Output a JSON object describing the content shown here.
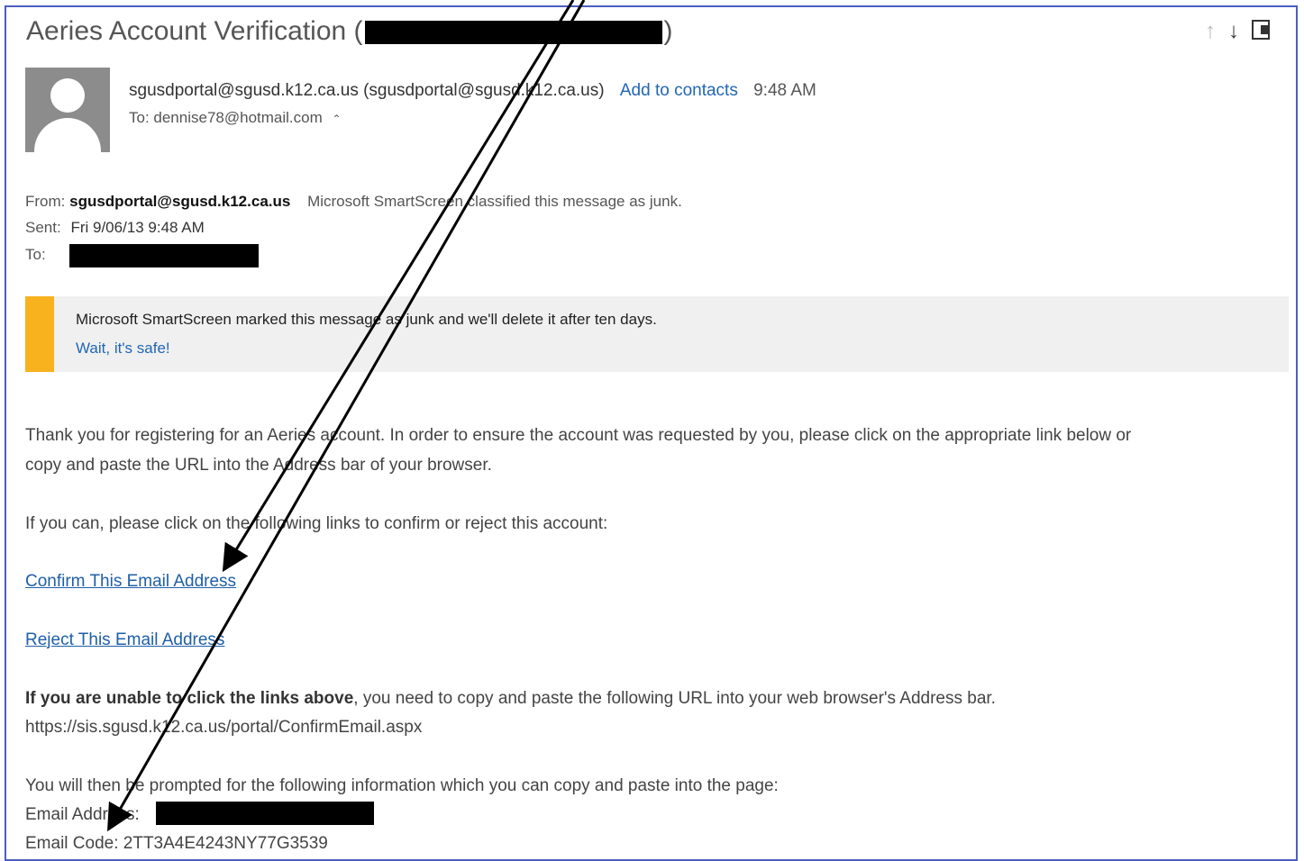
{
  "email": {
    "subject": "Aeries Account Verification (",
    "subject_close": ")",
    "sender_line": "sgusdportal@sgusd.k12.ca.us (sgusdportal@sgusd.k12.ca.us)",
    "add_to_contacts": "Add to contacts",
    "time": "9:48 AM",
    "to_line": "To: dennise78@hotmail.com",
    "to_toggle_icon": "double-chevron-up",
    "from_label": "From:",
    "from_value": "sgusdportal@sgusd.k12.ca.us",
    "junk_note": "Microsoft SmartScreen classified this message as junk.",
    "sent_label": "Sent:",
    "sent_value": "Fri 9/06/13 9:48 AM",
    "to_label": "To:"
  },
  "junk_banner": {
    "message": "Microsoft SmartScreen marked this message as junk and we'll delete it after ten days.",
    "safe_link": "Wait, it's safe!",
    "accent": "#f7b21e"
  },
  "body": {
    "para1_line1": "Thank you for registering for an Aeries account. In order to ensure the account was requested by you, please click on the appropriate link below or",
    "para1_line2": "copy and paste the URL into the Address bar of your browser.",
    "para2": "If you can, please click on the following links to confirm or reject this account:",
    "confirm_link": "Confirm This Email Address",
    "reject_link": "Reject This Email Address",
    "unable_bold": "If you are unable to click the links above",
    "unable_rest": ", you need to copy and paste the following URL into your web browser's Address bar.",
    "url": "https://sis.sgusd.k12.ca.us/portal/ConfirmEmail.aspx",
    "prompt": "You will then be prompted for the following information which you can copy and paste into the page:",
    "email_address_label": "Email Address:",
    "email_code": "Email Code: 2TT3A4E4243NY77G3539"
  },
  "toolbar": {
    "icons": [
      "arrow-up",
      "arrow-down",
      "popout"
    ]
  },
  "colors": {
    "link": "#2266b5",
    "frame_border": "#4a5fc1"
  }
}
